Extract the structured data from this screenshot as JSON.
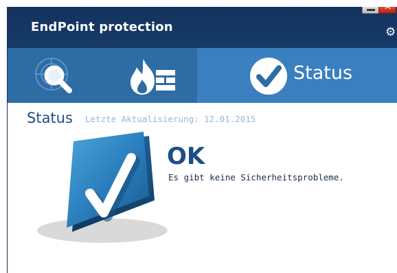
{
  "window": {
    "title": "EndPoint protection",
    "minimize_icon": "minimize-icon",
    "close_icon": "close-icon",
    "close_glyph": "✕",
    "settings_icon": "gear-icon"
  },
  "nav": {
    "tabs": [
      {
        "icon": "scan-magnifier-icon",
        "label": ""
      },
      {
        "icon": "firewall-flame-icon",
        "label": ""
      },
      {
        "icon": "status-check-icon",
        "label": "Status"
      }
    ],
    "active_tab": "Status"
  },
  "content": {
    "heading": "Status",
    "last_update": "Letzte Aktualisierung: 12.01.2015",
    "result_title": "OK",
    "result_message": "Es gibt keine Sicherheitsprobleme."
  },
  "colors": {
    "titlebar": "#14335e",
    "navbar": "#2e6ca4",
    "active_tab": "#3a7fbf",
    "heading_blue": "#1d4e86"
  }
}
